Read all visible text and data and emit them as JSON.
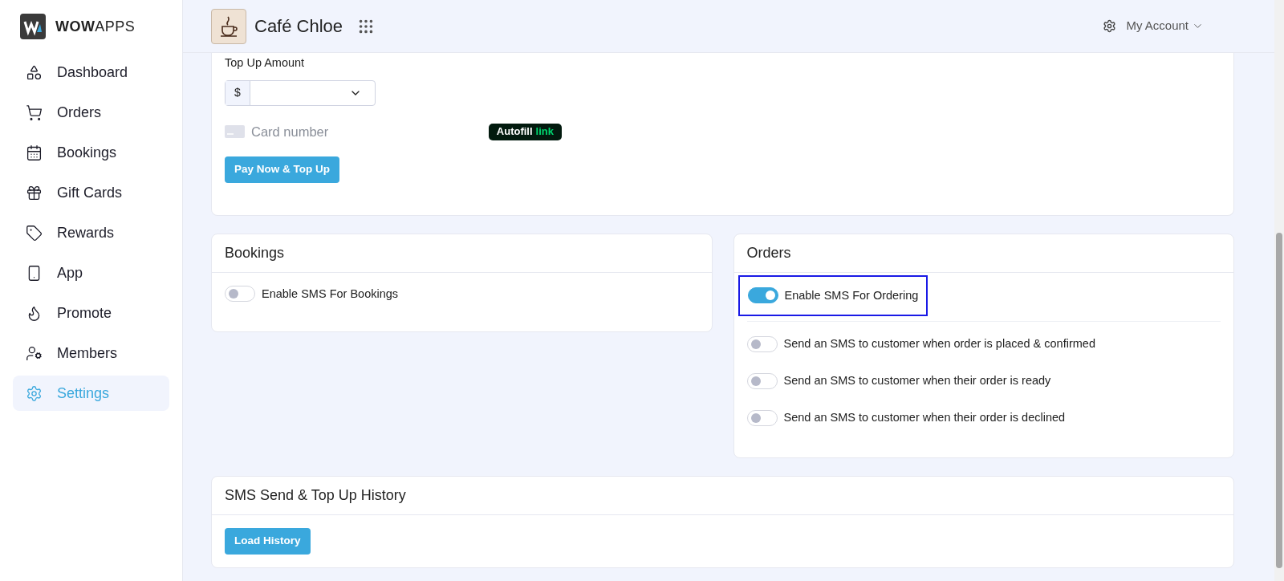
{
  "brand": {
    "name": "**WOW**APPS"
  },
  "nav": [
    {
      "label": "Dashboard",
      "kind": "dashboard",
      "selected": false
    },
    {
      "label": "Orders",
      "kind": "orders",
      "selected": false
    },
    {
      "label": "Bookings",
      "kind": "bookings",
      "selected": false
    },
    {
      "label": "Gift Cards",
      "kind": "gift",
      "selected": false
    },
    {
      "label": "Rewards",
      "kind": "rewards",
      "selected": false
    },
    {
      "label": "App",
      "kind": "app",
      "selected": false
    },
    {
      "label": "Promote",
      "kind": "promote",
      "selected": false
    },
    {
      "label": "Members",
      "kind": "members",
      "selected": false
    },
    {
      "label": "Settings",
      "kind": "settings",
      "selected": true
    }
  ],
  "header": {
    "business": "Café Chloe",
    "account": "My Account"
  },
  "top_up": {
    "label": "Top Up Amount",
    "currency": "$",
    "card_placeholder": "Card number",
    "autofill": {
      "label": "Autofill",
      "brand": "link"
    },
    "button": "Pay Now & Top Up"
  },
  "bookings": {
    "title": "Bookings",
    "toggles": [
      {
        "label": "Enable SMS For Bookings",
        "on": false
      }
    ]
  },
  "orders": {
    "title": "Orders",
    "master": {
      "label": "Enable SMS For Ordering",
      "on": true,
      "focused": true
    },
    "toggles": [
      {
        "label": "Send an SMS to customer when order is placed & confirmed",
        "on": false
      },
      {
        "label": "Send an SMS to customer when their order is ready",
        "on": false
      },
      {
        "label": "Send an SMS to customer when their order is declined",
        "on": false
      }
    ]
  },
  "history": {
    "title": "SMS Send & Top Up History",
    "button": "Load History"
  }
}
